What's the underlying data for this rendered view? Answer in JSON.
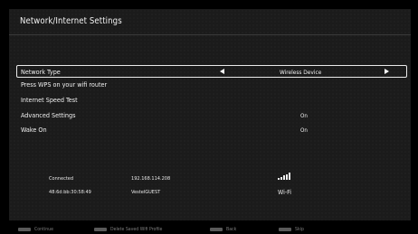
{
  "header": {
    "title": "Network/Internet Settings"
  },
  "menu": {
    "network_type": {
      "label": "Network Type",
      "value": "Wireless Device"
    },
    "items": [
      {
        "label": "Press WPS on your wifi router",
        "value": ""
      },
      {
        "label": "Internet Speed Test",
        "value": ""
      },
      {
        "label": "Advanced Settings",
        "value": "On"
      },
      {
        "label": "Wake On",
        "value": "On"
      }
    ]
  },
  "status": {
    "connection": "Connected",
    "ip_address": "192.168.114.208",
    "mac_address": "48:6d:bb:30:58:49",
    "ssid": "VestelGUEST",
    "connection_type": "Wi-Fi",
    "signal_level": 1.0
  },
  "footer": {
    "continue_label": "Continue",
    "delete_label": "Delete Saved Wifi Profile",
    "back_label": "Back",
    "skip_label": "Skip"
  },
  "icons": [
    "left-arrow-icon",
    "right-arrow-icon",
    "signal-strength-icon"
  ]
}
